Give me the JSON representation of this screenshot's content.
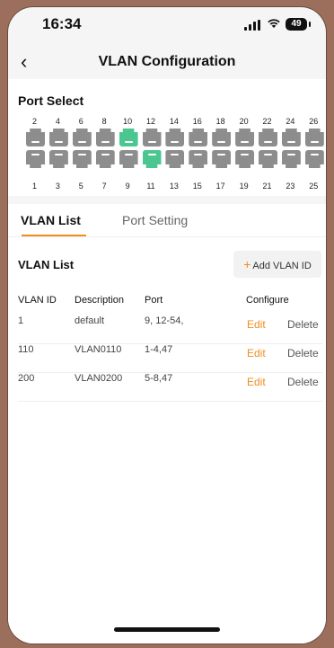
{
  "status_bar": {
    "time": "16:34",
    "battery": "49"
  },
  "nav": {
    "back_icon": "‹",
    "title": "VLAN Configuration"
  },
  "port_select": {
    "title": "Port Select",
    "top_numbers": [
      "2",
      "4",
      "6",
      "8",
      "10",
      "12",
      "14",
      "16",
      "18",
      "20",
      "22",
      "24",
      "26"
    ],
    "bottom_numbers": [
      "1",
      "3",
      "5",
      "7",
      "9",
      "11",
      "13",
      "15",
      "17",
      "19",
      "21",
      "23",
      "25"
    ],
    "active_top": [
      "10"
    ],
    "active_bottom": [
      "11"
    ],
    "active_color": "#4cc690"
  },
  "tabs": [
    {
      "label": "VLAN List"
    },
    {
      "label": "Port Setting"
    }
  ],
  "vlan_list": {
    "title": "VLAN List",
    "add_label": "Add VLAN ID",
    "add_icon": "+",
    "headers": {
      "id": "VLAN ID",
      "description": "Description",
      "port": "Port",
      "configure": "Configure"
    },
    "rows": [
      {
        "id": "1",
        "description": "default",
        "port": "9, 12-54,",
        "edit": "Edit",
        "delete": "Delete"
      },
      {
        "id": "110",
        "description": "VLAN0110",
        "port": "1-4,47",
        "edit": "Edit",
        "delete": "Delete"
      },
      {
        "id": "200",
        "description": "VLAN0200",
        "port": "5-8,47",
        "edit": "Edit",
        "delete": "Delete"
      }
    ]
  },
  "accent_color": "#f28c1f"
}
